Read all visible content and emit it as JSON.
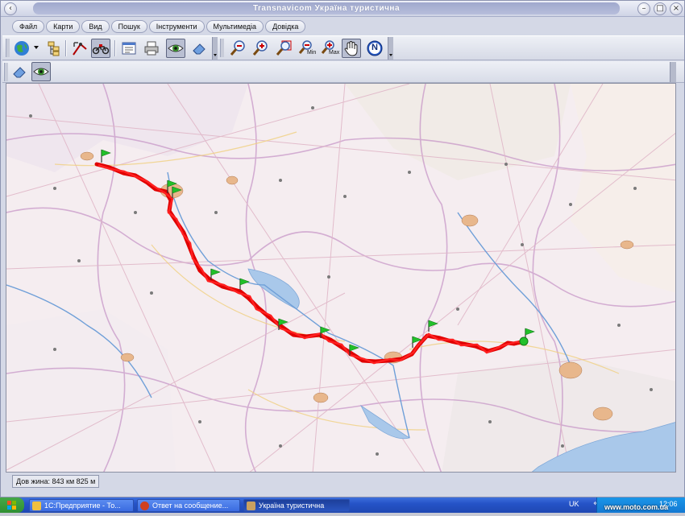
{
  "window": {
    "title": "Transnavicom Україна туристична"
  },
  "menu": [
    {
      "label": "Файл"
    },
    {
      "label": "Карти"
    },
    {
      "label": "Вид"
    },
    {
      "label": "Пошук"
    },
    {
      "label": "Інструменти"
    },
    {
      "label": "Мультимедіа"
    },
    {
      "label": "Довідка"
    }
  ],
  "toolbar": {
    "zoom_min_label": "Min",
    "zoom_max_label": "Max",
    "north_label": "N"
  },
  "status": {
    "route_length": "Дов жина: 843 км 825 м"
  },
  "taskbar": {
    "tasks": [
      {
        "label": "1С:Предприятие - То..."
      },
      {
        "label": "Ответ на сообщение..."
      },
      {
        "label": "Україна туристична"
      }
    ],
    "language": "UK",
    "watermark": "www.moto.com.ua",
    "clock": "12:06"
  },
  "colors": {
    "route": "#e00000",
    "flag": "#22c02a",
    "water": "#a9c8ea",
    "land": "#f4ecef"
  },
  "icons": [
    "globe-icon",
    "layers-icon",
    "route-measure-icon",
    "motorbike-icon",
    "properties-icon",
    "print-icon",
    "eye-icon",
    "eraser-icon",
    "zoom-out-icon",
    "zoom-in-icon",
    "zoom-area-icon",
    "zoom-min-icon",
    "zoom-max-icon",
    "hand-pan-icon",
    "north-icon"
  ]
}
